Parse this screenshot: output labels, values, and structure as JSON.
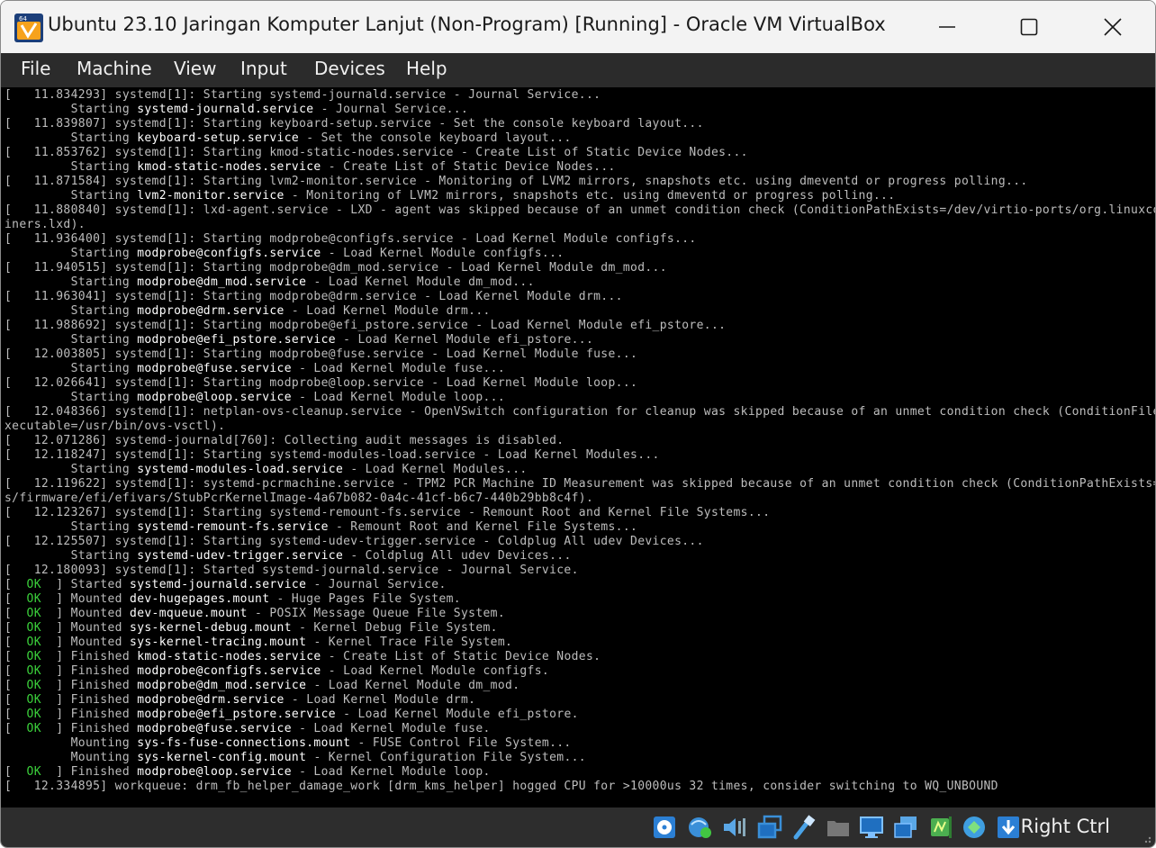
{
  "window": {
    "title": "Ubuntu 23.10 Jaringan Komputer Lanjut (Non-Program) [Running] - Oracle VM VirtualBox",
    "app_icon_badge": "64"
  },
  "menu": [
    "File",
    "Machine",
    "View",
    "Input",
    "Devices",
    "Help"
  ],
  "console_lines": [
    [
      {
        "t": "[   11.834293] systemd[1]: Starting systemd-journald.service - Journal Service..."
      }
    ],
    [
      {
        "t": "         Starting "
      },
      {
        "t": "systemd-journald.service",
        "c": "hl"
      },
      {
        "t": " - Journal Service..."
      }
    ],
    [
      {
        "t": "[   11.839807] systemd[1]: Starting keyboard-setup.service - Set the console keyboard layout..."
      }
    ],
    [
      {
        "t": "         Starting "
      },
      {
        "t": "keyboard-setup.service",
        "c": "hl"
      },
      {
        "t": " - Set the console keyboard layout..."
      }
    ],
    [
      {
        "t": "[   11.853762] systemd[1]: Starting kmod-static-nodes.service - Create List of Static Device Nodes..."
      }
    ],
    [
      {
        "t": "         Starting "
      },
      {
        "t": "kmod-static-nodes.service",
        "c": "hl"
      },
      {
        "t": " - Create List of Static Device Nodes..."
      }
    ],
    [
      {
        "t": "[   11.871584] systemd[1]: Starting lvm2-monitor.service - Monitoring of LVM2 mirrors, snapshots etc. using dmeventd or progress polling..."
      }
    ],
    [
      {
        "t": "         Starting "
      },
      {
        "t": "lvm2-monitor.service",
        "c": "hl"
      },
      {
        "t": " - Monitoring of LVM2 mirrors, snapshots etc. using dmeventd or progress polling..."
      }
    ],
    [
      {
        "t": "[   11.880840] systemd[1]: lxd-agent.service - LXD - agent was skipped because of an unmet condition check (ConditionPathExists=/dev/virtio-ports/org.linuxconta"
      }
    ],
    [
      {
        "t": "iners.lxd)."
      }
    ],
    [
      {
        "t": "[   11.936400] systemd[1]: Starting modprobe@configfs.service - Load Kernel Module configfs..."
      }
    ],
    [
      {
        "t": "         Starting "
      },
      {
        "t": "modprobe@configfs.service",
        "c": "hl"
      },
      {
        "t": " - Load Kernel Module configfs..."
      }
    ],
    [
      {
        "t": "[   11.940515] systemd[1]: Starting modprobe@dm_mod.service - Load Kernel Module dm_mod..."
      }
    ],
    [
      {
        "t": "         Starting "
      },
      {
        "t": "modprobe@dm_mod.service",
        "c": "hl"
      },
      {
        "t": " - Load Kernel Module dm_mod..."
      }
    ],
    [
      {
        "t": "[   11.963041] systemd[1]: Starting modprobe@drm.service - Load Kernel Module drm..."
      }
    ],
    [
      {
        "t": "         Starting "
      },
      {
        "t": "modprobe@drm.service",
        "c": "hl"
      },
      {
        "t": " - Load Kernel Module drm..."
      }
    ],
    [
      {
        "t": "[   11.988692] systemd[1]: Starting modprobe@efi_pstore.service - Load Kernel Module efi_pstore..."
      }
    ],
    [
      {
        "t": "         Starting "
      },
      {
        "t": "modprobe@efi_pstore.service",
        "c": "hl"
      },
      {
        "t": " - Load Kernel Module efi_pstore..."
      }
    ],
    [
      {
        "t": "[   12.003805] systemd[1]: Starting modprobe@fuse.service - Load Kernel Module fuse..."
      }
    ],
    [
      {
        "t": "         Starting "
      },
      {
        "t": "modprobe@fuse.service",
        "c": "hl"
      },
      {
        "t": " - Load Kernel Module fuse..."
      }
    ],
    [
      {
        "t": "[   12.026641] systemd[1]: Starting modprobe@loop.service - Load Kernel Module loop..."
      }
    ],
    [
      {
        "t": "         Starting "
      },
      {
        "t": "modprobe@loop.service",
        "c": "hl"
      },
      {
        "t": " - Load Kernel Module loop..."
      }
    ],
    [
      {
        "t": "[   12.048366] systemd[1]: netplan-ovs-cleanup.service - OpenVSwitch configuration for cleanup was skipped because of an unmet condition check (ConditionFileIsE"
      }
    ],
    [
      {
        "t": "xecutable=/usr/bin/ovs-vsctl)."
      }
    ],
    [
      {
        "t": "[   12.071286] systemd-journald[760]: Collecting audit messages is disabled."
      }
    ],
    [
      {
        "t": "[   12.118247] systemd[1]: Starting systemd-modules-load.service - Load Kernel Modules..."
      }
    ],
    [
      {
        "t": "         Starting "
      },
      {
        "t": "systemd-modules-load.service",
        "c": "hl"
      },
      {
        "t": " - Load Kernel Modules..."
      }
    ],
    [
      {
        "t": "[   12.119622] systemd[1]: systemd-pcrmachine.service - TPM2 PCR Machine ID Measurement was skipped because of an unmet condition check (ConditionPathExists=/sy"
      }
    ],
    [
      {
        "t": "s/firmware/efi/efivars/StubPcrKernelImage-4a67b082-0a4c-41cf-b6c7-440b29bb8c4f)."
      }
    ],
    [
      {
        "t": "[   12.123267] systemd[1]: Starting systemd-remount-fs.service - Remount Root and Kernel File Systems..."
      }
    ],
    [
      {
        "t": "         Starting "
      },
      {
        "t": "systemd-remount-fs.service",
        "c": "hl"
      },
      {
        "t": " - Remount Root and Kernel File Systems..."
      }
    ],
    [
      {
        "t": "[   12.125507] systemd[1]: Starting systemd-udev-trigger.service - Coldplug All udev Devices..."
      }
    ],
    [
      {
        "t": "         Starting "
      },
      {
        "t": "systemd-udev-trigger.service",
        "c": "hl"
      },
      {
        "t": " - Coldplug All udev Devices..."
      }
    ],
    [
      {
        "t": "[   12.180093] systemd[1]: Started systemd-journald.service - Journal Service."
      }
    ],
    [
      {
        "t": "[  "
      },
      {
        "t": "OK",
        "c": "ok"
      },
      {
        "t": "  ] Started "
      },
      {
        "t": "systemd-journald.service",
        "c": "hl"
      },
      {
        "t": " - Journal Service."
      }
    ],
    [
      {
        "t": "[  "
      },
      {
        "t": "OK",
        "c": "ok"
      },
      {
        "t": "  ] Mounted "
      },
      {
        "t": "dev-hugepages.mount",
        "c": "hl"
      },
      {
        "t": " - Huge Pages File System."
      }
    ],
    [
      {
        "t": "[  "
      },
      {
        "t": "OK",
        "c": "ok"
      },
      {
        "t": "  ] Mounted "
      },
      {
        "t": "dev-mqueue.mount",
        "c": "hl"
      },
      {
        "t": " - POSIX Message Queue File System."
      }
    ],
    [
      {
        "t": "[  "
      },
      {
        "t": "OK",
        "c": "ok"
      },
      {
        "t": "  ] Mounted "
      },
      {
        "t": "sys-kernel-debug.mount",
        "c": "hl"
      },
      {
        "t": " - Kernel Debug File System."
      }
    ],
    [
      {
        "t": "[  "
      },
      {
        "t": "OK",
        "c": "ok"
      },
      {
        "t": "  ] Mounted "
      },
      {
        "t": "sys-kernel-tracing.mount",
        "c": "hl"
      },
      {
        "t": " - Kernel Trace File System."
      }
    ],
    [
      {
        "t": "[  "
      },
      {
        "t": "OK",
        "c": "ok"
      },
      {
        "t": "  ] Finished "
      },
      {
        "t": "kmod-static-nodes.service",
        "c": "hl"
      },
      {
        "t": " - Create List of Static Device Nodes."
      }
    ],
    [
      {
        "t": "[  "
      },
      {
        "t": "OK",
        "c": "ok"
      },
      {
        "t": "  ] Finished "
      },
      {
        "t": "modprobe@configfs.service",
        "c": "hl"
      },
      {
        "t": " - Load Kernel Module configfs."
      }
    ],
    [
      {
        "t": "[  "
      },
      {
        "t": "OK",
        "c": "ok"
      },
      {
        "t": "  ] Finished "
      },
      {
        "t": "modprobe@dm_mod.service",
        "c": "hl"
      },
      {
        "t": " - Load Kernel Module dm_mod."
      }
    ],
    [
      {
        "t": "[  "
      },
      {
        "t": "OK",
        "c": "ok"
      },
      {
        "t": "  ] Finished "
      },
      {
        "t": "modprobe@drm.service",
        "c": "hl"
      },
      {
        "t": " - Load Kernel Module drm."
      }
    ],
    [
      {
        "t": "[  "
      },
      {
        "t": "OK",
        "c": "ok"
      },
      {
        "t": "  ] Finished "
      },
      {
        "t": "modprobe@efi_pstore.service",
        "c": "hl"
      },
      {
        "t": " - Load Kernel Module efi_pstore."
      }
    ],
    [
      {
        "t": "[  "
      },
      {
        "t": "OK",
        "c": "ok"
      },
      {
        "t": "  ] Finished "
      },
      {
        "t": "modprobe@fuse.service",
        "c": "hl"
      },
      {
        "t": " - Load Kernel Module fuse."
      }
    ],
    [
      {
        "t": "         Mounting "
      },
      {
        "t": "sys-fs-fuse-connections.mount",
        "c": "hl"
      },
      {
        "t": " - FUSE Control File System..."
      }
    ],
    [
      {
        "t": "         Mounting "
      },
      {
        "t": "sys-kernel-config.mount",
        "c": "hl"
      },
      {
        "t": " - Kernel Configuration File System..."
      }
    ],
    [
      {
        "t": "[  "
      },
      {
        "t": "OK",
        "c": "ok"
      },
      {
        "t": "  ] Finished "
      },
      {
        "t": "modprobe@loop.service",
        "c": "hl"
      },
      {
        "t": " - Load Kernel Module loop."
      }
    ],
    [
      {
        "t": "[   12.334895] workqueue: drm_fb_helper_damage_work [drm_kms_helper] hogged CPU for >10000us 32 times, consider switching to WQ_UNBOUND"
      }
    ]
  ],
  "statusbar": {
    "icons": [
      "optical-drive-icon",
      "network-icon",
      "audio-icon",
      "shared-folders-icon",
      "usb-icon",
      "hard-disk-icon",
      "display-icon",
      "video-capture-icon",
      "cpu-icon",
      "mouse-integration-icon",
      "keyboard-capture-icon"
    ],
    "host_key": "Right Ctrl"
  },
  "colors": {
    "console_bg": "#000000",
    "console_text": "#bdbdbd",
    "console_highlight": "#ffffff",
    "ok_green": "#3bd13b",
    "menubar_bg": "#2b2b2b",
    "statusbar_bg": "#2d2d2d"
  }
}
